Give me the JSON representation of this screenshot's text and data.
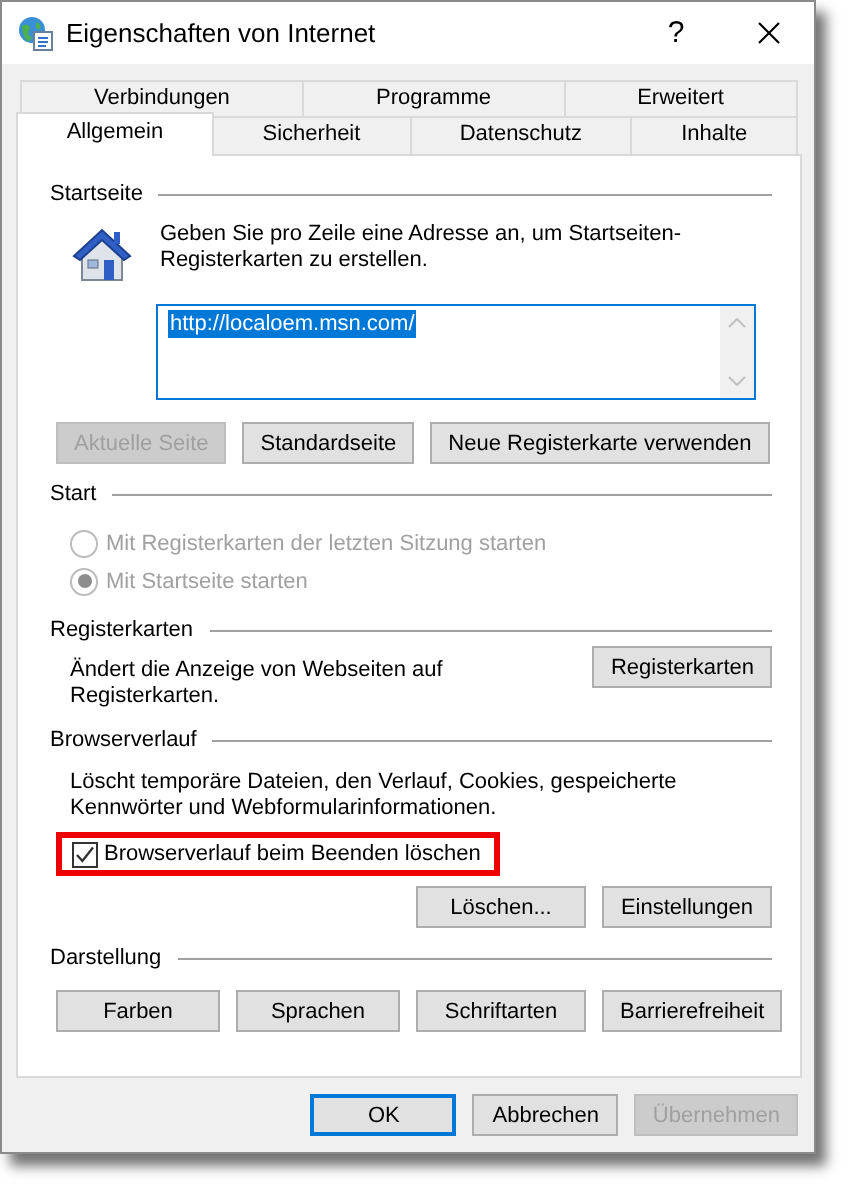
{
  "window": {
    "title": "Eigenschaften von Internet",
    "help": "?"
  },
  "tab_rows": [
    [
      {
        "label": "Verbindungen",
        "selected": false
      },
      {
        "label": "Programme",
        "selected": false
      },
      {
        "label": "Erweitert",
        "selected": false
      }
    ],
    [
      {
        "label": "Allgemein",
        "selected": true
      },
      {
        "label": "Sicherheit",
        "selected": false
      },
      {
        "label": "Datenschutz",
        "selected": false
      },
      {
        "label": "Inhalte",
        "selected": false
      }
    ]
  ],
  "sections": [
    {
      "kind": "homepage",
      "heading": "Startseite",
      "description": "Geben Sie pro Zeile eine Adresse an, um Startseiten-Registerkarten zu erstellen.",
      "addresses": {
        "value": "http://localoem.msn.com/",
        "selected": true
      },
      "buttons": [
        {
          "label": "Aktuelle Seite",
          "disabled": true
        },
        {
          "label": "Standardseite",
          "disabled": false
        },
        {
          "label": "Neue Registerkarte verwenden",
          "disabled": false
        }
      ]
    },
    {
      "kind": "options",
      "heading": "Start",
      "options": [
        {
          "label": "Mit Registerkarten der letzten Sitzung starten",
          "selected": false,
          "disabled": true
        },
        {
          "label": "Mit Startseite starten",
          "selected": true,
          "disabled": true
        }
      ]
    },
    {
      "kind": "side",
      "heading": "Registerkarten",
      "description": "Ändert die Anzeige von Webseiten auf Registerkarten.",
      "buttons": [
        {
          "label": "Registerkarten",
          "disabled": false
        }
      ]
    },
    {
      "kind": "history",
      "heading": "Browserverlauf",
      "description": "Löscht temporäre Dateien, den Verlauf, Cookies, gespeicherte Kennwörter und Webformularinformationen.",
      "checkbox": {
        "label": "Browserverlauf beim Beenden löschen",
        "checked": true,
        "highlighted": true
      },
      "buttons": [
        {
          "label": "Löschen...",
          "disabled": false
        },
        {
          "label": "Einstellungen",
          "disabled": false
        }
      ]
    },
    {
      "kind": "buttons",
      "heading": "Darstellung",
      "buttons": [
        {
          "label": "Farben",
          "disabled": false
        },
        {
          "label": "Sprachen",
          "disabled": false
        },
        {
          "label": "Schriftarten",
          "disabled": false
        },
        {
          "label": "Barrierefreiheit",
          "disabled": false
        }
      ]
    }
  ],
  "footer_buttons": [
    {
      "label": "OK",
      "default": true,
      "disabled": false
    },
    {
      "label": "Abbrechen",
      "default": false,
      "disabled": false
    },
    {
      "label": "Übernehmen",
      "default": false,
      "disabled": true
    }
  ]
}
